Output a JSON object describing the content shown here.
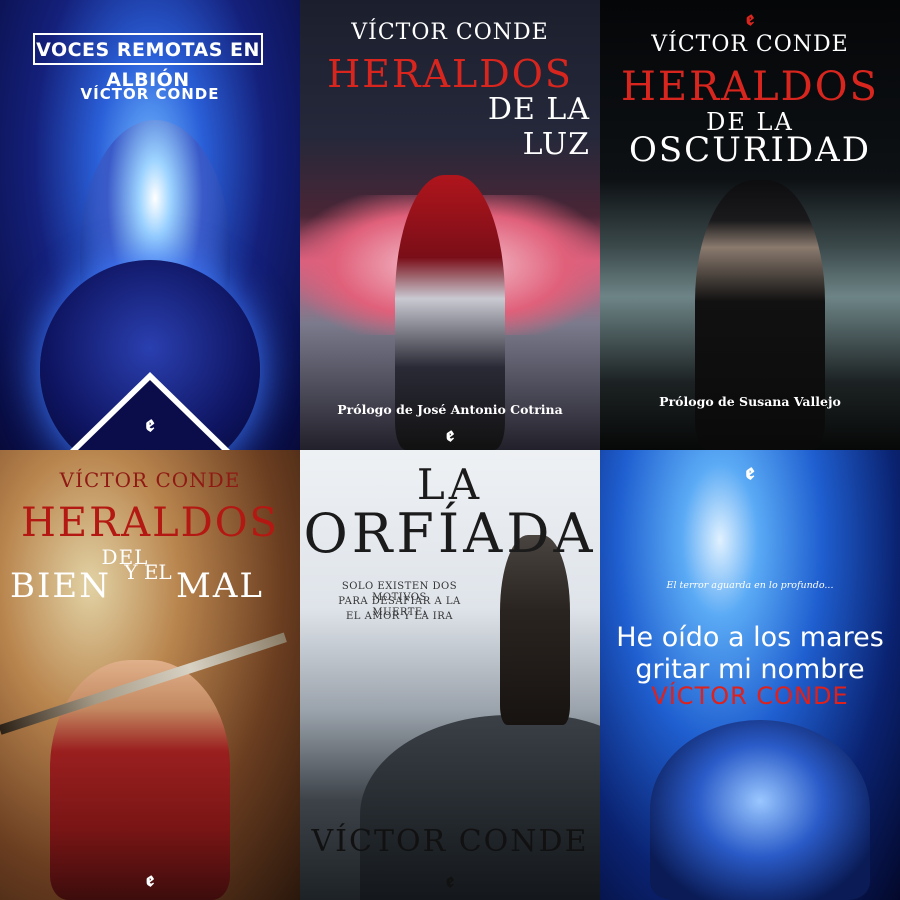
{
  "covers": [
    {
      "title": "VOCES REMOTAS EN ALBIÓN",
      "author": "VÍCTOR CONDE",
      "logo": "ꬲ"
    },
    {
      "author": "VÍCTOR CONDE",
      "title_line1": "HERALDOS",
      "title_line2": "DE LA LUZ",
      "prologue": "Prólogo de José Antonio Cotrina",
      "logo": "ꬲ"
    },
    {
      "logo": "ꬲ",
      "author": "VÍCTOR CONDE",
      "title_line1": "HERALDOS",
      "title_line2": "DE LA",
      "title_line3": "OSCURIDAD",
      "prologue": "Prólogo de Susana Vallejo"
    },
    {
      "author": "VÍCTOR CONDE",
      "title_line1": "HERALDOS",
      "title_line2": "DEL",
      "title_bien": "BIEN",
      "title_yel": "Y EL",
      "title_mal": "MAL",
      "logo": "ꬲ"
    },
    {
      "title_line1": "LA",
      "title_line2": "ORFÍADA",
      "tagline_1": "SOLO EXISTEN DOS MOTIVOS",
      "tagline_2": "PARA DESAFIAR A LA MUERTE:",
      "tagline_3": "EL AMOR Y LA IRA",
      "author": "VÍCTOR CONDE",
      "logo": "ꬲ"
    },
    {
      "logo": "ꬲ",
      "tagline": "El terror aguarda en lo profundo...",
      "title_line1": "He oído a los mares",
      "title_line2": "gritar mi nombre",
      "author": "VÍCTOR CONDE"
    }
  ]
}
